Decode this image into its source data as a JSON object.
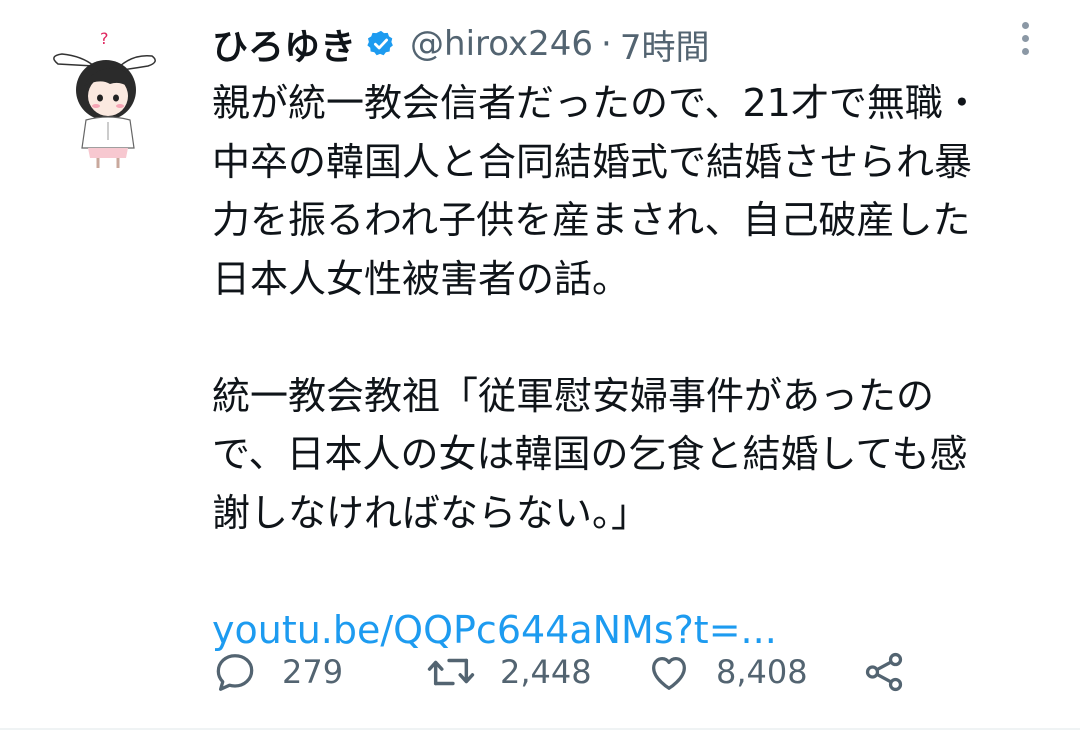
{
  "tweet": {
    "author": {
      "display_name": "ひろゆき",
      "handle": "@hirox246",
      "separator": "·",
      "time": "7時間",
      "avatar_icon": "anime-girl-bunny-ears-avatar",
      "verified_icon": "verified-badge-icon"
    },
    "body": {
      "paragraph1": [
        "親が統一教会信者だったので、21才で無職・",
        "中卒の韓国人と合同結婚式で結婚させられ暴",
        "力を振るわれ子供を産まされ、自己破産した",
        "日本人女性被害者の話。"
      ],
      "paragraph2": [
        "統一教会教祖「従軍慰安婦事件があったの",
        "で、日本人の女は韓国の乞食と結婚しても感",
        "謝しなければならない。」"
      ],
      "link": "youtu.be/QQPc644aNMs?t=..."
    },
    "actions": {
      "reply_count": "279",
      "retweet_count": "2,448",
      "like_count": "8,408"
    },
    "colors": {
      "link": "#1d9bf0",
      "secondary_text": "#536471",
      "verified": "#1d9bf0"
    }
  }
}
